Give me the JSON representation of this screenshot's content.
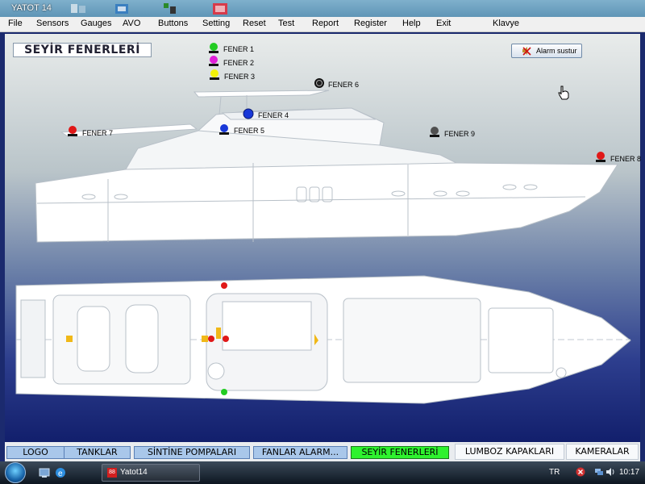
{
  "window": {
    "title": "YATOT  14"
  },
  "menu": [
    "File",
    "Sensors",
    "Gauges",
    "AVO",
    "Buttons",
    "Setting",
    "Reset",
    "Test",
    "Report",
    "Register",
    "Help",
    "Exit",
    "Klavye"
  ],
  "page": {
    "title": "SEYİR FENERLERİ",
    "alarm_button": "Alarm sustur"
  },
  "lamps": [
    {
      "label": "FENER 1",
      "color": "#22cc22"
    },
    {
      "label": "FENER 2",
      "color": "#e020d8"
    },
    {
      "label": "FENER 3",
      "color": "#f2f20a"
    },
    {
      "label": "FENER 4",
      "color": "#1838d8"
    },
    {
      "label": "FENER 5",
      "color": "#1838d8"
    },
    {
      "label": "FENER 6",
      "color": "#202020"
    },
    {
      "label": "FENER 7",
      "color": "#e01818"
    },
    {
      "label": "FENER 8",
      "color": "#e01818"
    },
    {
      "label": "FENER 9",
      "color": "#505050"
    }
  ],
  "tabs": [
    {
      "label": "LOGO",
      "active": false
    },
    {
      "label": "TANKLAR",
      "active": false
    },
    {
      "label": "SİNTİNE POMPALARI",
      "active": false
    },
    {
      "label": "FANLAR ALARM...",
      "active": false
    },
    {
      "label": "SEYİR  FENERLERİ",
      "active": true
    },
    {
      "label": "LUMBOZ KAPAKLARI",
      "active": false
    },
    {
      "label": "KAMERALAR",
      "active": false
    }
  ],
  "taskbar": {
    "task_label": "Yatot14",
    "task_icon_text": "88",
    "language": "TR",
    "clock": "10:17"
  }
}
